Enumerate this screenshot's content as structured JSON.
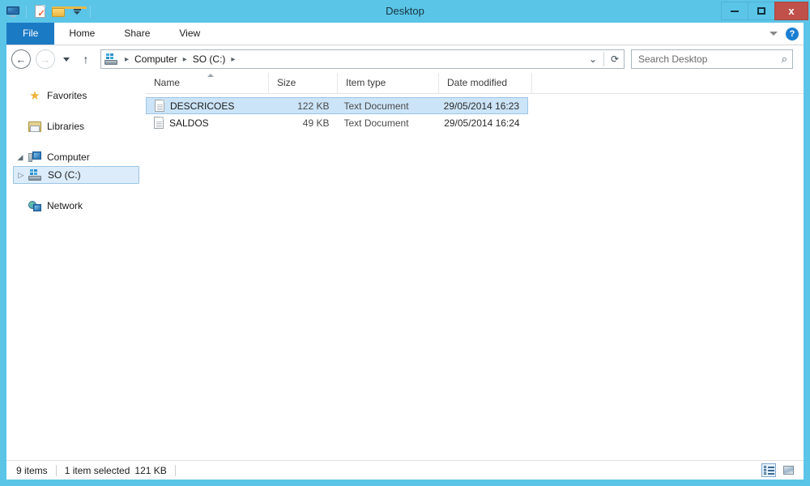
{
  "window": {
    "title": "Desktop",
    "accent_color": "#5bc5e8",
    "close_color": "#c0504a",
    "minimize_label": "Minimize",
    "maximize_label": "Maximize",
    "close_label": "x"
  },
  "quick_access": {
    "items": [
      {
        "name": "computer-icon",
        "label": "Computer"
      },
      {
        "name": "properties-icon",
        "label": "Properties"
      },
      {
        "name": "new-folder-icon",
        "label": "New folder"
      },
      {
        "name": "customize-dropdown",
        "label": "Customize Quick Access Toolbar"
      }
    ]
  },
  "ribbon": {
    "tabs": [
      {
        "label": "File",
        "active": true
      },
      {
        "label": "Home",
        "active": false
      },
      {
        "label": "Share",
        "active": false
      },
      {
        "label": "View",
        "active": false
      }
    ],
    "expand_label": "Minimize the Ribbon",
    "help_label": "?"
  },
  "address_bar": {
    "back_label": "←",
    "forward_label": "→",
    "recent_label": "Recent locations",
    "up_label": "↑",
    "breadcrumb": [
      "Computer",
      "SO (C:)"
    ],
    "separator": "▸",
    "dropdown_label": "⌄",
    "refresh_label": "⟳"
  },
  "search": {
    "placeholder": "Search Desktop",
    "value": "",
    "icon": "search-icon"
  },
  "sidebar": {
    "items": [
      {
        "label": "Favorites",
        "icon": "star-icon",
        "expander": "",
        "selected": false
      },
      {
        "label": "Libraries",
        "icon": "libraries-icon",
        "expander": "",
        "selected": false
      },
      {
        "label": "Computer",
        "icon": "computer-icon",
        "expander": "◢",
        "selected": false
      },
      {
        "label": "SO (C:)",
        "icon": "drive-icon",
        "expander": "▷",
        "selected": true
      },
      {
        "label": "Network",
        "icon": "network-icon",
        "expander": "",
        "selected": false
      }
    ]
  },
  "file_list": {
    "columns": [
      {
        "label": "Name",
        "sorted": "asc"
      },
      {
        "label": "Size",
        "sorted": ""
      },
      {
        "label": "Item type",
        "sorted": ""
      },
      {
        "label": "Date modified",
        "sorted": ""
      }
    ],
    "rows": [
      {
        "name": "DESCRICOES",
        "size": "122 KB",
        "type": "Text Document",
        "date": "29/05/2014 16:23",
        "selected": true,
        "icon": "text-document-icon"
      },
      {
        "name": "SALDOS",
        "size": "49 KB",
        "type": "Text Document",
        "date": "29/05/2014 16:24",
        "selected": false,
        "icon": "text-document-icon"
      }
    ]
  },
  "status_bar": {
    "item_count": "9 items",
    "selection": "1 item selected",
    "selection_size": "121 KB",
    "views": [
      {
        "name": "details-view-button",
        "label": "Details view",
        "active": true
      },
      {
        "name": "large-icons-view-button",
        "label": "Large icons view",
        "active": false
      }
    ]
  }
}
